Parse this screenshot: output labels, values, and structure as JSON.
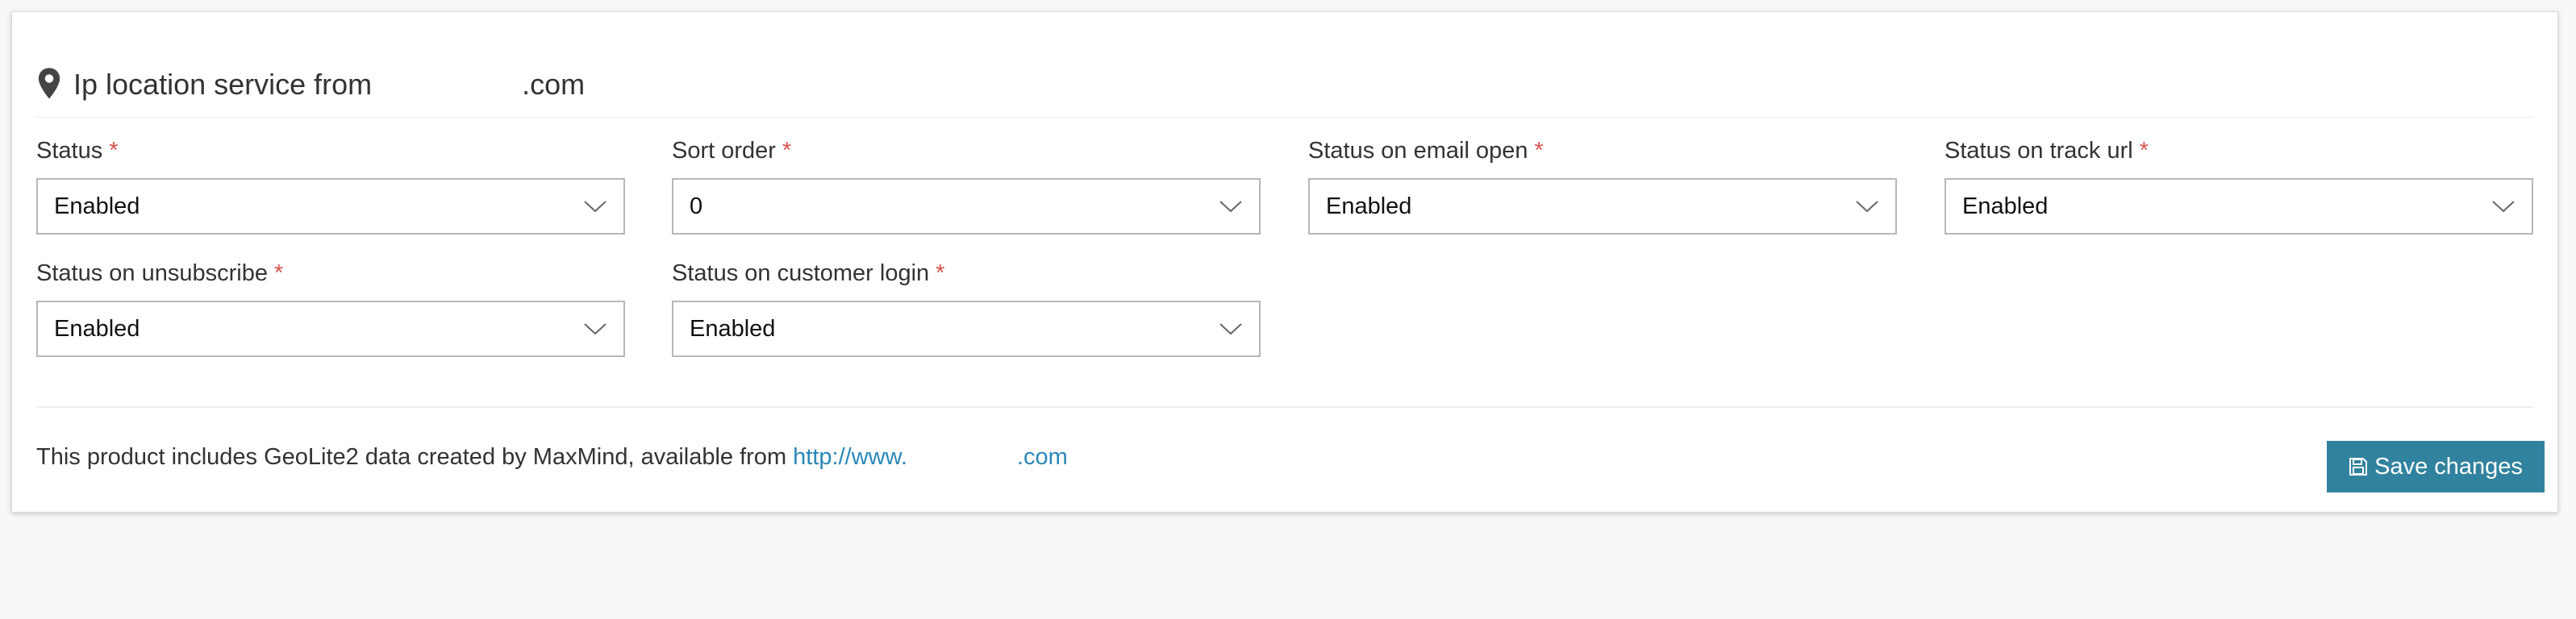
{
  "panel": {
    "title": "Ip location service from ",
    "title_domain": ".com",
    "icon": "map-pin-icon"
  },
  "fields": [
    {
      "label": "Status",
      "required": "*",
      "value": "Enabled"
    },
    {
      "label": "Sort order",
      "required": "*",
      "value": "0"
    },
    {
      "label": "Status on email open",
      "required": "*",
      "value": "Enabled"
    },
    {
      "label": "Status on track url",
      "required": "*",
      "value": "Enabled"
    },
    {
      "label": "Status on unsubscribe",
      "required": "*",
      "value": "Enabled"
    },
    {
      "label": "Status on customer login",
      "required": "*",
      "value": "Enabled"
    }
  ],
  "footer": {
    "note": "This product includes GeoLite2 data created by MaxMind, available from ",
    "link_text": "http://www.",
    "link_suffix": ".com"
  },
  "actions": {
    "save_label": "Save changes",
    "save_icon": "floppy-disk-icon"
  },
  "colors": {
    "accent": "#31829f",
    "link": "#2a88b8",
    "required": "#d9534f",
    "background": "#f8f8f8"
  }
}
